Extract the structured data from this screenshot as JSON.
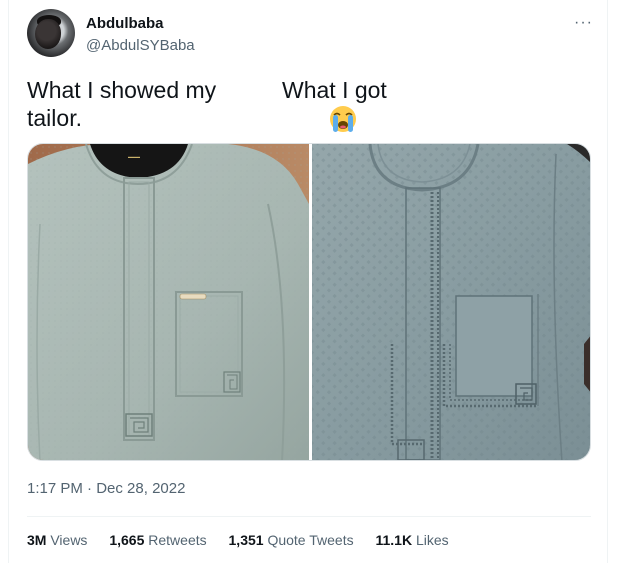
{
  "author": {
    "name": "Abdulbaba",
    "handle": "@AbdulSYBaba"
  },
  "menu": {
    "more_glyph": "···"
  },
  "tweet": {
    "left_caption": "What I showed my tailor.",
    "right_caption": "What I got",
    "emoji": "loudly-crying-face"
  },
  "media": {
    "images": [
      {
        "description_icon": "kaftan-photo",
        "label": ""
      },
      {
        "description_icon": "kaftan-photo",
        "label": ""
      }
    ]
  },
  "meta": {
    "time": "1:17 PM",
    "separator": "·",
    "date": "Dec 28, 2022"
  },
  "stats": {
    "views_count": "3M",
    "views_label": "Views",
    "retweets_count": "1,665",
    "retweets_label": "Retweets",
    "quotes_count": "1,351",
    "quotes_label": "Quote Tweets",
    "likes_count": "11.1K",
    "likes_label": "Likes"
  },
  "colors": {
    "text_primary": "#0f1419",
    "text_secondary": "#536471",
    "divider": "#eff3f4",
    "fabric_left": "#a9b8b3",
    "fabric_right": "#8a9ea4"
  }
}
